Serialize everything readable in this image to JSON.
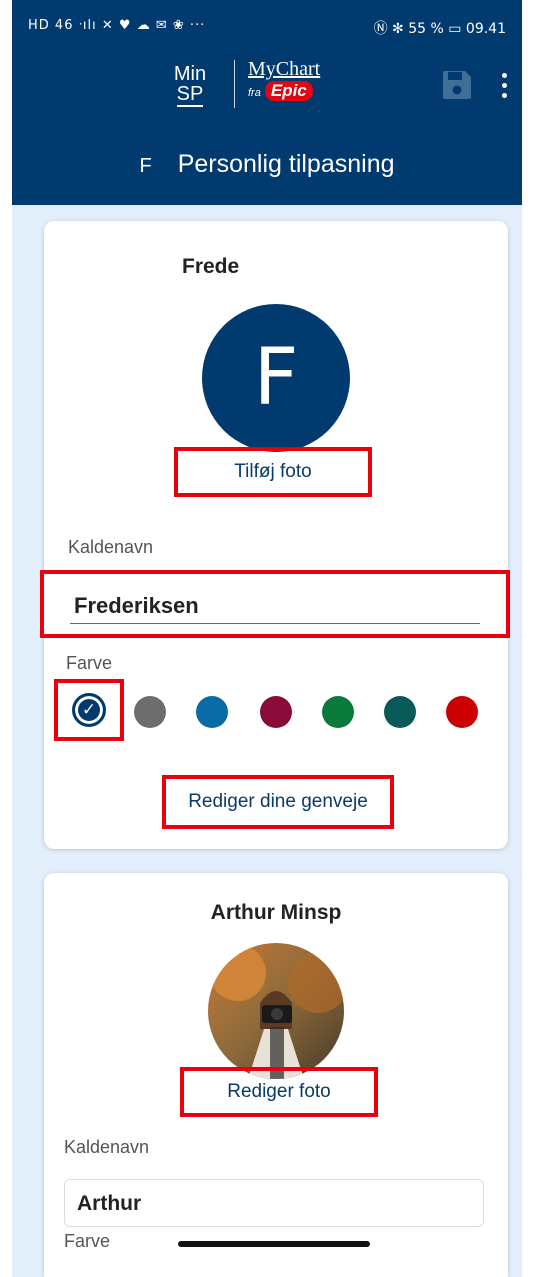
{
  "status_bar": {
    "left_icons": "HD 46 ᐧılı ✕ ♥ ☁ ✉ ❀ ···",
    "right": "Ⓝ ✻ 55 % ▭ 09.41"
  },
  "header": {
    "logo_minsp_line1": "Min",
    "logo_minsp_line2": "SP",
    "logo_mychart": "MyChart",
    "logo_fra": "fra",
    "logo_epic": "Epic",
    "initial": "F",
    "title": "Personlig tilpasning",
    "save_icon": "save-icon",
    "more_icon": "more-vertical-icon"
  },
  "profile1": {
    "name": "Frede",
    "avatar_initial": "F",
    "add_photo": "Tilføj foto",
    "nickname_label": "Kaldenavn",
    "nickname_value": "Frederiksen",
    "color_label": "Farve",
    "colors": [
      "#003a6e",
      "#6d6d6d",
      "#0a6aa6",
      "#8a0a3a",
      "#0a7a3a",
      "#0a5a5a",
      "#cc0000"
    ],
    "selected_color_index": 0,
    "edit_shortcuts": "Rediger dine genveje"
  },
  "profile2": {
    "name": "Arthur Minsp",
    "edit_photo": "Rediger foto",
    "nickname_label": "Kaldenavn",
    "nickname_value": "Arthur",
    "color_label": "Farve"
  },
  "colors": {
    "header_bg": "#003a6e",
    "content_bg": "#e2eefa",
    "highlight": "#e8000f",
    "link": "#0a3a6a"
  }
}
